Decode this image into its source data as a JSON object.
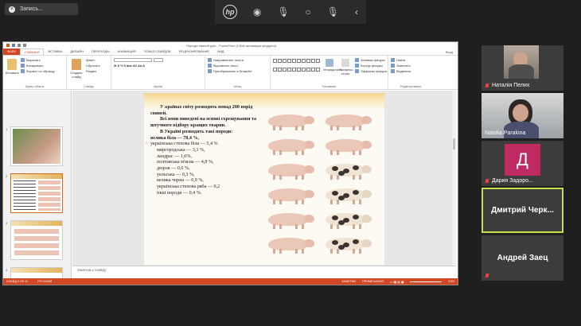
{
  "recording": {
    "label": "Запись..."
  },
  "top_toolbar": {
    "logo": "hp"
  },
  "ppt": {
    "title": "Породы свиней.pptx - PowerPoint (Сбой активации продукта)",
    "tabs": [
      "ФАЙЛ",
      "ГЛАВНАЯ",
      "ВСТАВКА",
      "ДИЗАЙН",
      "ПЕРЕХОДЫ",
      "АНИМАЦИЯ",
      "ПОКАЗ СЛАЙДОВ",
      "РЕЦЕНЗИРОВАНИЕ",
      "ВИД"
    ],
    "user": "Вход",
    "ribbon": {
      "clipboard": {
        "paste": "Вставить",
        "cut": "Вырезать",
        "copy": "Копировать",
        "format": "Формат по образцу",
        "label": "Буфер обмена"
      },
      "slides": {
        "new": "Создать слайд",
        "layout": "Макет",
        "reset": "Сбросить",
        "section": "Раздел",
        "label": "Слайды"
      },
      "font": {
        "label": "Шрифт"
      },
      "paragraph": {
        "dir": "Направление текста",
        "align": "Выровнять текст",
        "smart": "Преобразовать в SmartArt",
        "label": "Абзац"
      },
      "drawing": {
        "arrange": "Упорядочить",
        "styles": "Экспресс-стили",
        "fill": "Заливка фигуры",
        "outline": "Контур фигуры",
        "effects": "Эффекты фигуры",
        "label": "Рисование"
      },
      "editing": {
        "find": "Найти",
        "replace": "Заменить",
        "select": "Выделить",
        "label": "Редактирование"
      }
    },
    "slide": {
      "lines": [
        {
          "text": "У країнах світу розводять понад 200 порід свиней.",
          "bold": true,
          "bullet": true
        },
        {
          "text": "Всі вони виведені на основі схрещування та штучного відбору кращих тварин.",
          "bold": true,
          "bullet": true
        },
        {
          "text": "В Україні розводять такі породи:",
          "bold": true,
          "bullet": true
        },
        {
          "text": "велика біла — 78,4 %,",
          "bold": true,
          "bullet": false
        },
        {
          "text": "українська степова біла — 5,4 %",
          "bold": false,
          "bullet": true
        },
        {
          "text": "миргородська — 3,3 %,",
          "bold": false,
          "bullet": false
        },
        {
          "text": "ландрас — 1,6%,",
          "bold": false,
          "bullet": false
        },
        {
          "text": "полтавська м'ясна — 4,8 %,",
          "bold": false,
          "bullet": false
        },
        {
          "text": "дюрок — 0,6 %,",
          "bold": false,
          "bullet": false
        },
        {
          "text": "уельська — 0,3 %,",
          "bold": false,
          "bullet": false
        },
        {
          "text": "велика чорна — 0,9 %,",
          "bold": false,
          "bullet": false
        },
        {
          "text": "українська степова ряба — 0,2",
          "bold": false,
          "bullet": false
        },
        {
          "text": "інші породи — 0,4 %.",
          "bold": false,
          "bullet": false
        }
      ]
    },
    "notes_placeholder": "Заметки к слайду",
    "status": {
      "slide": "СЛАЙД 2 ИЗ 11",
      "lang": "РУССКИЙ",
      "notes": "ЗАМЕТКИ",
      "comments": "ПРИМЕЧАНИЯ",
      "zoom": "43%"
    }
  },
  "participants": [
    {
      "name": "Наталія Пелих",
      "muted": true
    },
    {
      "name": "Natalia Parakina",
      "muted": false
    },
    {
      "name": "Дария Задоро...",
      "muted": true,
      "initial": "Д"
    },
    {
      "name": "Дмитрий Черк...",
      "muted": false,
      "active": true
    },
    {
      "name": "Андрей Заец",
      "muted": true
    }
  ]
}
